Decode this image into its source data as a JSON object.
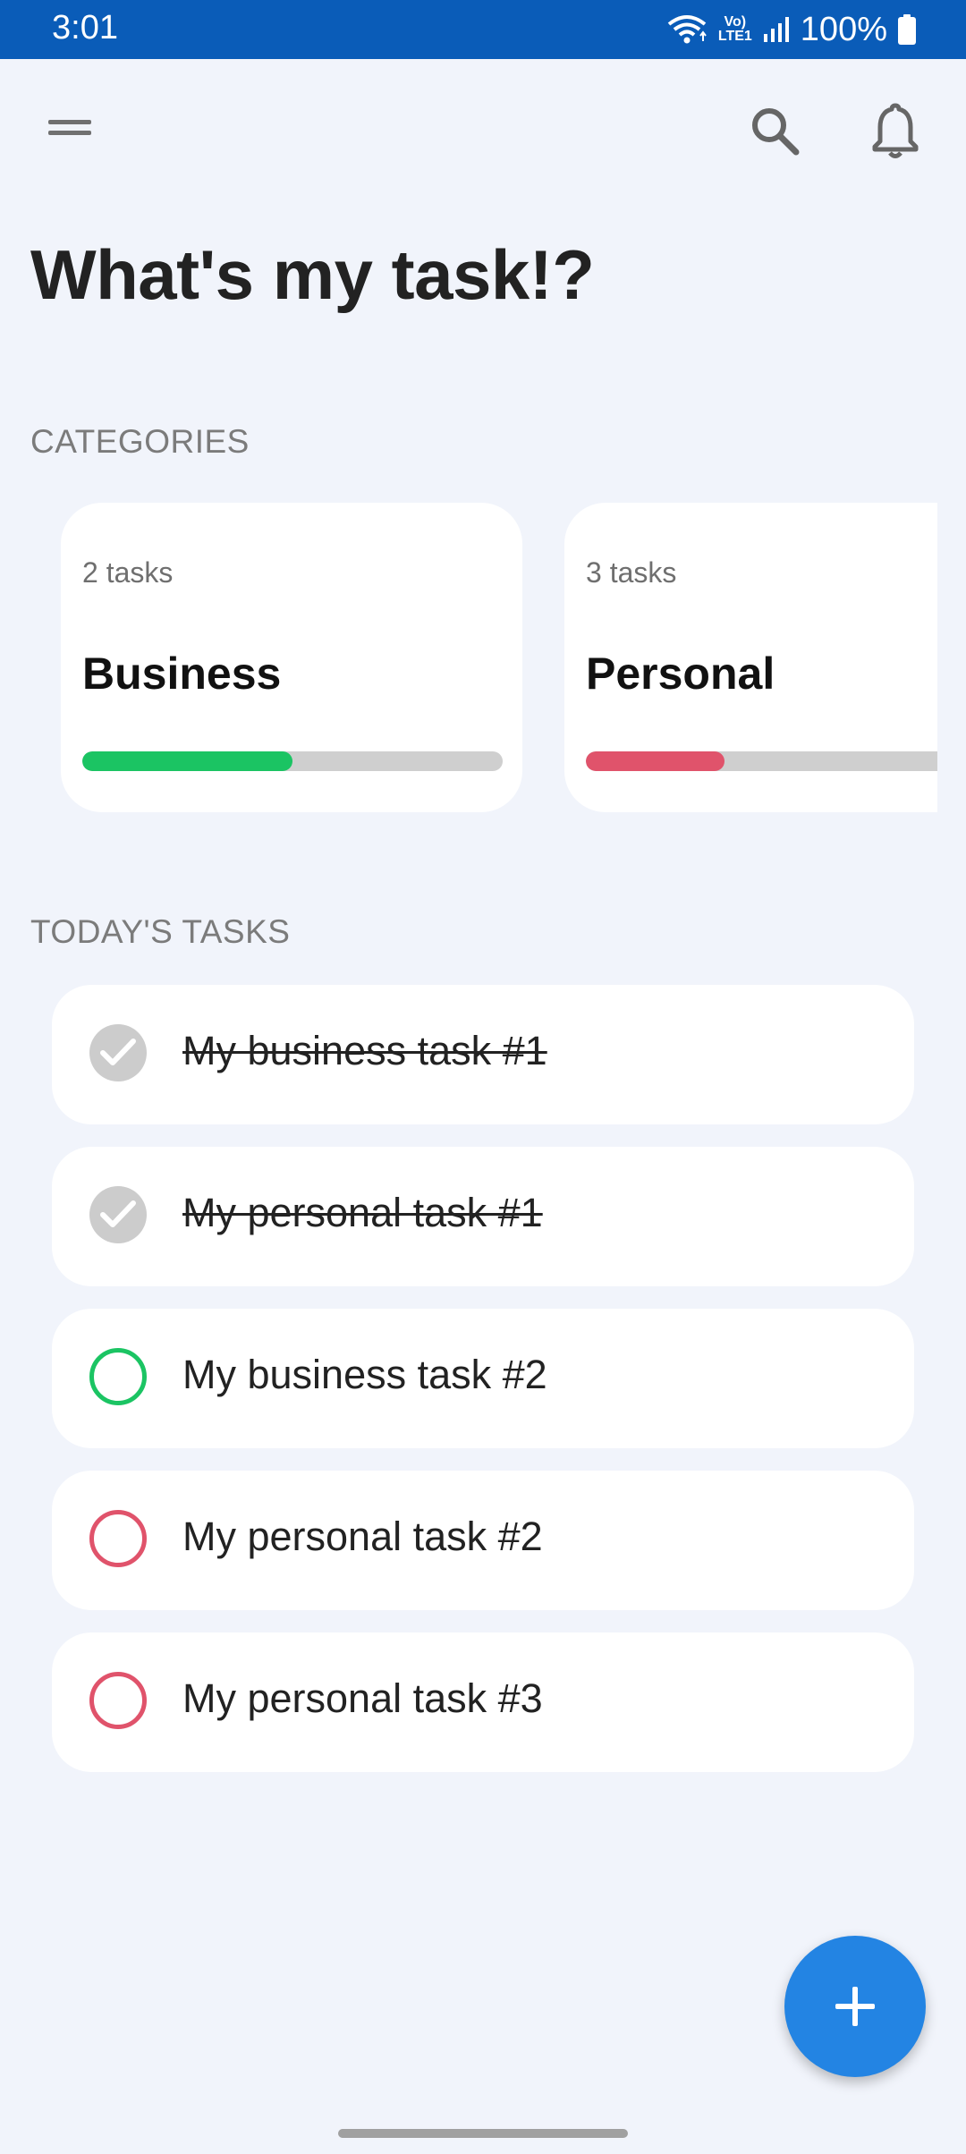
{
  "status_bar": {
    "time": "3:01",
    "battery": "100%",
    "network_top": "Vo)",
    "network_bottom": "LTE1"
  },
  "app": {
    "title": "What's my task!?",
    "categories_label": "CATEGORIES",
    "today_label": "TODAY'S TASKS"
  },
  "categories": [
    {
      "count": "2 tasks",
      "name": "Business",
      "progress": 0.5,
      "color": "#1bc463"
    },
    {
      "count": "3 tasks",
      "name": "Personal",
      "progress": 0.33,
      "color": "#e0536b"
    }
  ],
  "tasks": [
    {
      "label": "My business task #1",
      "done": true,
      "color": "#1bc463"
    },
    {
      "label": "My personal task #1",
      "done": true,
      "color": "#e0536b"
    },
    {
      "label": "My business task #2",
      "done": false,
      "color": "#1bc463"
    },
    {
      "label": "My personal task #2",
      "done": false,
      "color": "#e0536b"
    },
    {
      "label": "My personal task #3",
      "done": false,
      "color": "#e0536b"
    }
  ],
  "icons": {
    "menu": "menu-icon",
    "search": "search-icon",
    "notifications": "bell-icon",
    "add": "plus-icon"
  },
  "colors": {
    "status_bar": "#0a5cb8",
    "fab": "#2384e3",
    "background": "#f1f4fb"
  }
}
